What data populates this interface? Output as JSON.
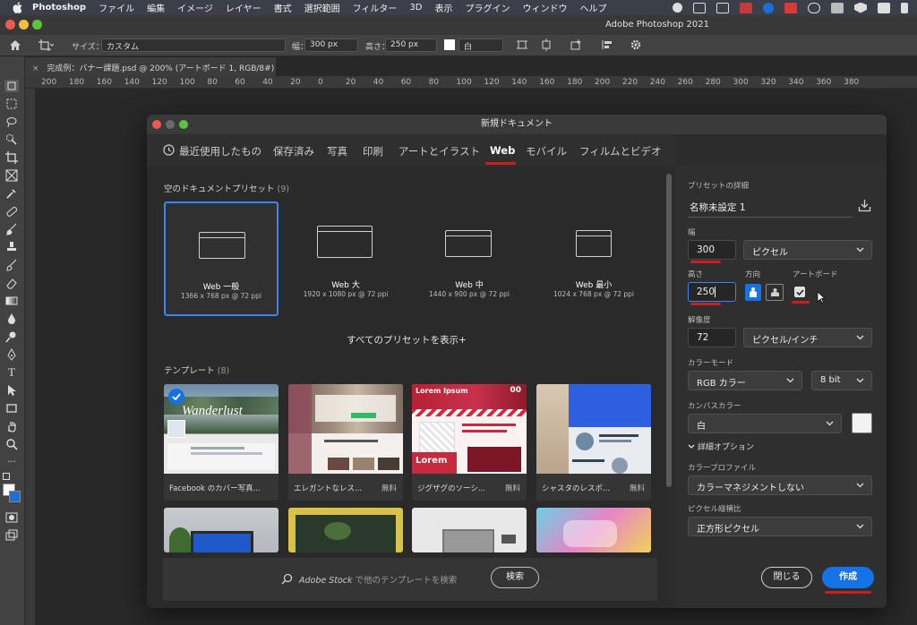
{
  "menubar": {
    "app": "Photoshop",
    "items": [
      "ファイル",
      "編集",
      "イメージ",
      "レイヤー",
      "書式",
      "選択範囲",
      "フィルター",
      "3D",
      "表示",
      "プラグイン",
      "ウィンドウ",
      "ヘルプ"
    ]
  },
  "app_title": "Adobe Photoshop 2021",
  "options_bar": {
    "size_label": "サイズ：",
    "size_value": "カスタム",
    "width_label": "幅：",
    "width_value": "300 px",
    "height_label": "高さ：",
    "height_value": "250 px",
    "fill_value": "白"
  },
  "document_tab": {
    "title": "完成例：バナー課題.psd @ 200% (アートボード 1, RGB/8#)"
  },
  "ruler_ticks": [
    "200",
    "180",
    "160",
    "140",
    "120",
    "100",
    "80",
    "60",
    "40",
    "20",
    "0",
    "20",
    "40",
    "60",
    "80",
    "100",
    "120",
    "140",
    "160",
    "180",
    "200",
    "220",
    "240",
    "260",
    "280",
    "300",
    "320",
    "340",
    "360",
    "380"
  ],
  "dialog": {
    "title": "新規ドキュメント",
    "tabs": [
      "最近使用したもの",
      "保存済み",
      "写真",
      "印刷",
      "アートとイラスト",
      "Web",
      "モバイル",
      "フィルムとビデオ"
    ],
    "active_tab": "Web",
    "blank_presets_title": "空のドキュメントプリセット",
    "blank_presets_count": "(9)",
    "presets": [
      {
        "name": "Web 一般",
        "dims": "1366 x 768 px @ 72 ppi"
      },
      {
        "name": "Web 大",
        "dims": "1920 x 1080 px @ 72 ppi"
      },
      {
        "name": "Web 中",
        "dims": "1440 x 900 px @ 72 ppi"
      },
      {
        "name": "Web 最小",
        "dims": "1024 x 768 px @ 72 ppi"
      }
    ],
    "show_all": "すべてのプリセットを表示+",
    "templates_title": "テンプレート",
    "templates_count": "(8)",
    "templates": [
      {
        "name": "Facebook のカバー写真...",
        "price": ""
      },
      {
        "name": "エレガントなレス...",
        "price": "無料"
      },
      {
        "name": "ジグザグのソーシ...",
        "price": "無料"
      },
      {
        "name": "シャスタのレスポ...",
        "price": "無料"
      }
    ],
    "template_texts": {
      "wanderlust": "Wanderlust",
      "lorem_ipsum": "Lorem Ipsum",
      "lorem": "Lorem",
      "count": "00"
    },
    "stock_search": {
      "brand": "Adobe Stock",
      "text": " で他のテンプレートを検索",
      "button": "検索"
    },
    "details": {
      "title": "プリセットの詳細",
      "doc_name": "名称未設定 1",
      "width_label": "幅",
      "width_value": "300",
      "width_unit": "ピクセル",
      "height_label": "高さ",
      "height_value": "250",
      "orientation_label": "方向",
      "artboard_label": "アートボード",
      "resolution_label": "解像度",
      "resolution_value": "72",
      "resolution_unit": "ピクセル/インチ",
      "color_mode_label": "カラーモード",
      "color_mode_value": "RGB カラー",
      "bit_depth": "8 bit",
      "canvas_color_label": "カンバスカラー",
      "canvas_color_value": "白",
      "advanced": "詳細オプション",
      "profile_label": "カラープロファイル",
      "profile_value": "カラーマネジメントしない",
      "pixel_aspect_label": "ピクセル縦横比",
      "pixel_aspect_value": "正方形ピクセル"
    },
    "buttons": {
      "close": "閉じる",
      "create": "作成"
    }
  }
}
